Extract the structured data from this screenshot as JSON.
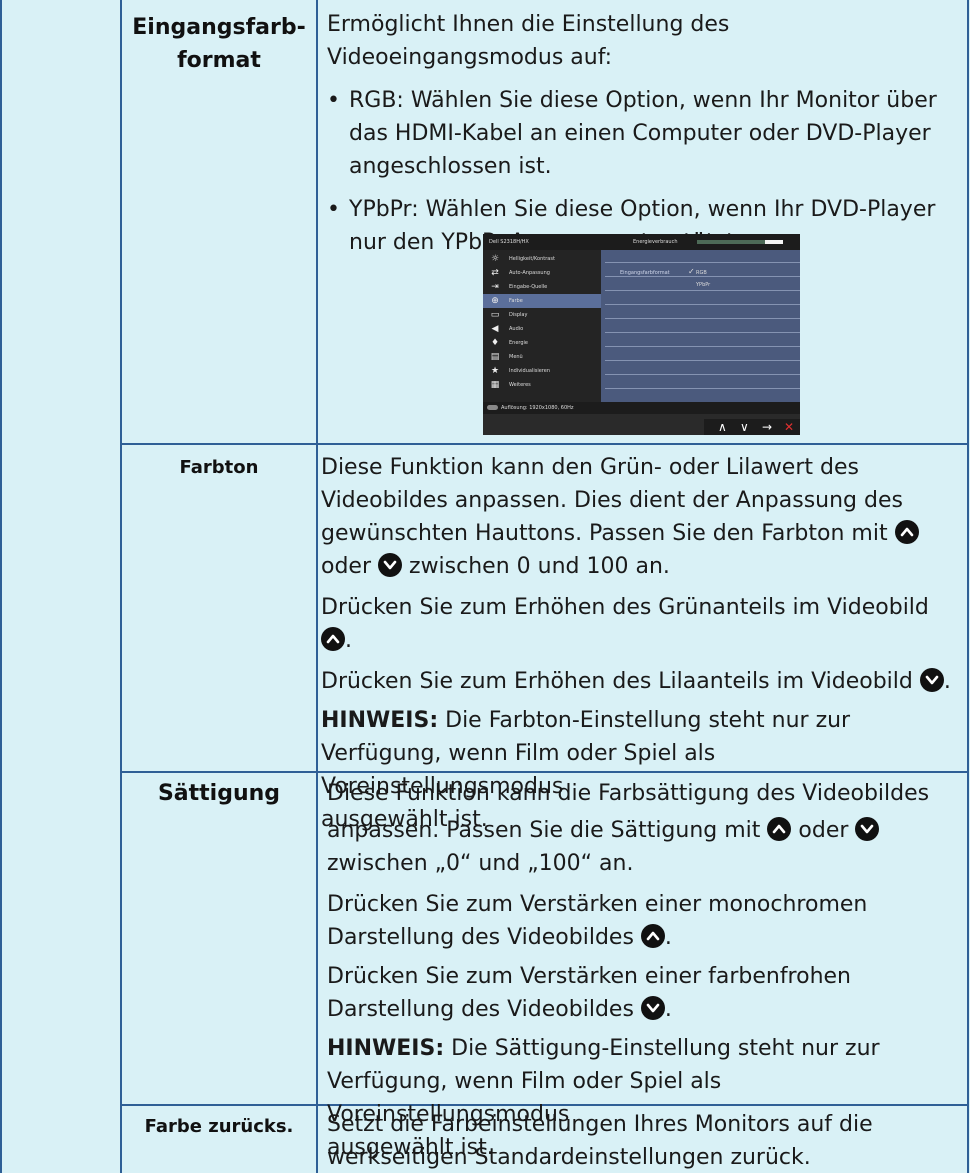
{
  "rows": [
    {
      "term": "Eingangsfarb-format",
      "term_line1": "Eingangsfarb-",
      "term_line2": "format",
      "intro1": "Ermöglicht Ihnen die Einstellung des",
      "intro2": "Videoeingangsmodus auf:",
      "bullet1": [
        "RGB: Wählen Sie diese Option, wenn Ihr Monitor über",
        "das HDMI-Kabel an einen Computer oder DVD-Player",
        "angeschlossen ist."
      ],
      "bullet2": [
        "YPbPr: Wählen Sie diese Option, wenn Ihr DVD-Player",
        "nur den YPbPr-Ausgang unterstützt."
      ]
    },
    {
      "term": "Farbton",
      "lines": [
        "Diese Funktion kann den Grün- oder Lilawert des",
        "Videobildes anpassen. Dies dient der Anpassung des",
        "gewünschten Hauttons. Passen Sie den Farbton mit",
        "oder",
        "zwischen 0 und 100 an."
      ],
      "green": "Drücken Sie zum Erhöhen des Grünanteils im Videobild",
      "lila": "Drücken Sie zum Erhöhen des Lilaanteils im Videobild",
      "note_label": "HINWEIS:",
      "note": [
        " Die Farbton-Einstellung steht nur zur",
        "Verfügung, wenn Film oder Spiel als Voreinstellungsmodus",
        "ausgewählt ist."
      ]
    },
    {
      "term": "Sättigung",
      "lines": [
        "Diese Funktion kann die Farbsättigung des Videobildes",
        "anpassen. Passen Sie die Sättigung mit",
        "oder",
        "zwischen „0“ und „100“ an."
      ],
      "mono": [
        "Drücken Sie zum Verstärken einer monochromen",
        "Darstellung des Videobildes"
      ],
      "vivid": [
        "Drücken Sie zum Verstärken einer farbenfrohen",
        "Darstellung des Videobildes"
      ],
      "note_label": "HINWEIS:",
      "note": [
        " Die Sättigung-Einstellung steht nur zur",
        "Verfügung, wenn Film oder Spiel als Voreinstellungsmodus",
        "ausgewählt ist."
      ]
    },
    {
      "term": "Farbe zurücks.",
      "lines": [
        "Setzt die Farbeinstellungen Ihres Monitors auf die",
        "werkseitigen Standardeinstellungen zurück."
      ]
    }
  ],
  "osd": {
    "model": "Dell S2318H/HX",
    "energy_label": "Energieverbrauch",
    "menu": [
      "Helligkeit/Kontrast",
      "Auto-Anpassung",
      "Eingabe-Quelle",
      "Farbe",
      "Display",
      "Audio",
      "Energie",
      "Menü",
      "Individualisieren",
      "Weiteres"
    ],
    "menu_icons": [
      "sun-icon",
      "auto-adjust-icon",
      "input-source-icon",
      "color-icon",
      "display-icon",
      "audio-icon",
      "energy-icon",
      "menu-icon",
      "star-icon",
      "others-icon"
    ],
    "setting_label": "Eingangsfarbformat",
    "options": [
      "RGB",
      "YPbPr"
    ],
    "checked": "✓",
    "resolution": "Auflösung: 1920x1080, 60Hz",
    "nav": [
      "∧",
      "∨",
      "→",
      "✕"
    ]
  },
  "colors": {
    "background": "#d9f1f6",
    "border": "#2f5f96"
  }
}
